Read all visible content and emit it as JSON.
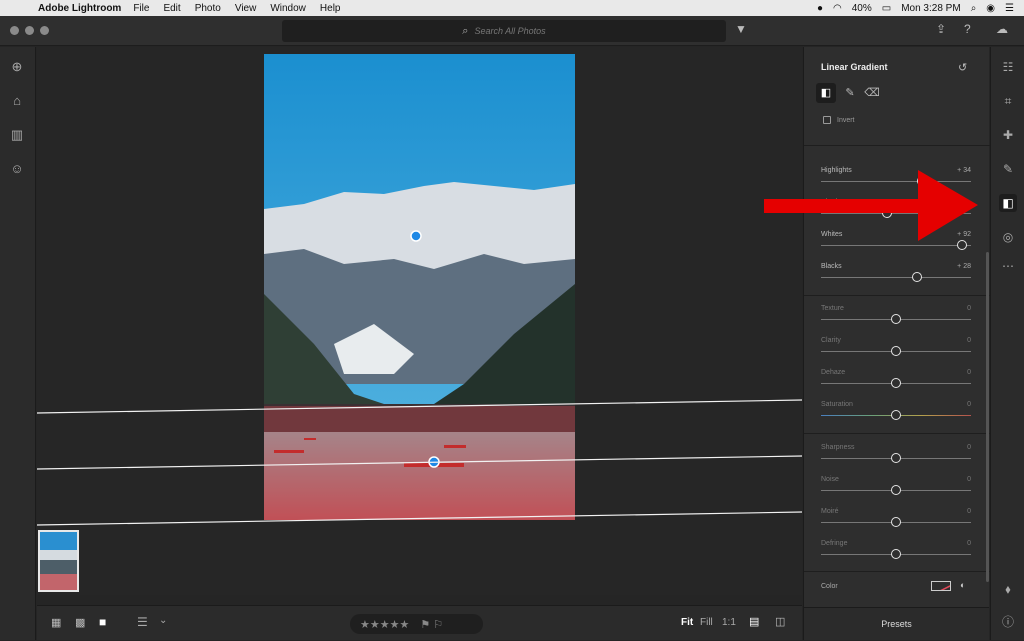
{
  "menubar": {
    "app_name": "Adobe Lightroom",
    "items": [
      "File",
      "Edit",
      "Photo",
      "View",
      "Window",
      "Help"
    ],
    "battery": "40%",
    "clock": "Mon 3:28 PM"
  },
  "search": {
    "placeholder": "Search All Photos"
  },
  "panel": {
    "title": "Linear Gradient",
    "invert_label": "Invert",
    "sliders": [
      {
        "label": "Highlights",
        "value": "+ 34",
        "position": 0.67
      },
      {
        "label": "Shadows",
        "value": "",
        "position": 0.44
      },
      {
        "label": "Whites",
        "value": "+ 92",
        "position": 0.94
      },
      {
        "label": "Blacks",
        "value": "+ 28",
        "position": 0.64
      },
      {
        "label": "Texture",
        "value": "0",
        "position": 0.5
      },
      {
        "label": "Clarity",
        "value": "0",
        "position": 0.5
      },
      {
        "label": "Dehaze",
        "value": "0",
        "position": 0.5
      },
      {
        "label": "Saturation",
        "value": "0",
        "position": 0.5
      },
      {
        "label": "Sharpness",
        "value": "0",
        "position": 0.5
      },
      {
        "label": "Noise",
        "value": "0",
        "position": 0.5
      },
      {
        "label": "Moiré",
        "value": "0",
        "position": 0.5
      },
      {
        "label": "Defringe",
        "value": "0",
        "position": 0.5
      }
    ],
    "color_label": "Color"
  },
  "bottombar": {
    "zoom_fit": "Fit",
    "zoom_fill": "Fill",
    "zoom_1to1": "1:1",
    "stars": "★★★★★"
  },
  "presets_label": "Presets",
  "colors": {
    "accent": "#1e88e5",
    "arrow": "#e50000",
    "mask": "#d9474f"
  }
}
